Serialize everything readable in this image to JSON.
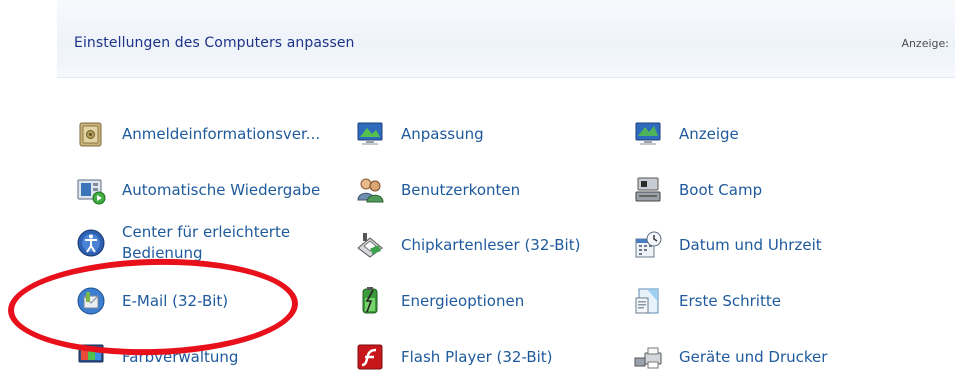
{
  "header": {
    "title": "Einstellungen des Computers anpassen",
    "view_label": "Anzeige:"
  },
  "items": [
    {
      "label": "Anmeldeinformationsver...",
      "icon": "credential-vault-icon"
    },
    {
      "label": "Anpassung",
      "icon": "personalization-icon"
    },
    {
      "label": "Anzeige",
      "icon": "display-icon"
    },
    {
      "label": "Automatische Wiedergabe",
      "icon": "autoplay-icon"
    },
    {
      "label": "Benutzerkonten",
      "icon": "user-accounts-icon"
    },
    {
      "label": "Boot Camp",
      "icon": "boot-camp-icon"
    },
    {
      "label": "Center für erleichterte Bedienung",
      "icon": "ease-of-access-icon"
    },
    {
      "label": "Chipkartenleser (32-Bit)",
      "icon": "card-reader-icon"
    },
    {
      "label": "Datum und Uhrzeit",
      "icon": "date-time-icon"
    },
    {
      "label": "E-Mail (32-Bit)",
      "icon": "mail-icon"
    },
    {
      "label": "Energieoptionen",
      "icon": "power-options-icon"
    },
    {
      "label": "Erste Schritte",
      "icon": "getting-started-icon"
    },
    {
      "label": "Farbverwaltung",
      "icon": "color-management-icon"
    },
    {
      "label": "Flash Player (32-Bit)",
      "icon": "flash-player-icon"
    },
    {
      "label": "Geräte und Drucker",
      "icon": "devices-printers-icon"
    }
  ],
  "annotation": {
    "color": "#e8111b"
  }
}
